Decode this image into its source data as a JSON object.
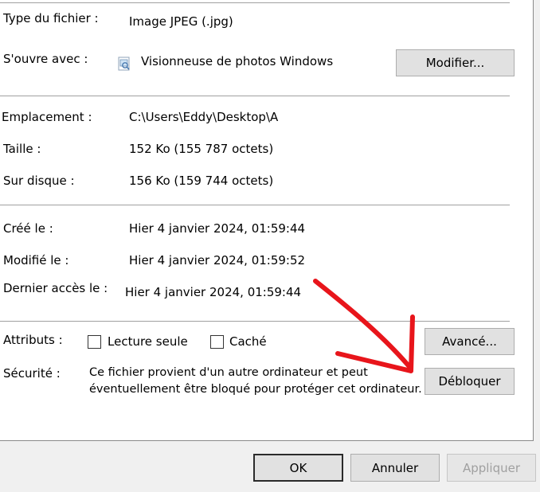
{
  "general": {
    "file_type_label": "Type du fichier :",
    "file_type_value": "Image JPEG (.jpg)",
    "opens_with_label": "S'ouvre avec :",
    "opens_with_value": "Visionneuse de photos Windows",
    "change_button": "Modifier...",
    "location_label": "Emplacement :",
    "location_value": "C:\\Users\\Eddy\\Desktop\\A",
    "size_label": "Taille :",
    "size_value": "152 Ko (155 787 octets)",
    "size_on_disk_label": "Sur disque :",
    "size_on_disk_value": "156 Ko (159 744 octets)",
    "created_label": "Créé le :",
    "created_value": "Hier 4 janvier 2024, 01:59:44",
    "modified_label": "Modifié le :",
    "modified_value": "Hier 4 janvier 2024, 01:59:52",
    "accessed_label": "Dernier accès le :",
    "accessed_value": "Hier 4 janvier 2024, 01:59:44",
    "attributes_label": "Attributs :",
    "readonly_label": "Lecture seule",
    "readonly_checked": false,
    "hidden_label": "Caché",
    "hidden_checked": false,
    "advanced_button": "Avancé...",
    "security_label": "Sécurité :",
    "security_text_line1": "Ce fichier provient d'un autre ordinateur et peut",
    "security_text_line2": "éventuellement être bloqué pour protéger cet ordinateur.",
    "unblock_button": "Débloquer"
  },
  "footer": {
    "ok_button": "OK",
    "cancel_button": "Annuler",
    "apply_button": "Appliquer",
    "apply_enabled": false
  },
  "icons": {
    "photo_viewer": "photo-viewer-icon",
    "annotation_arrow": "red-arrow"
  },
  "colors": {
    "arrow": "#e8151b",
    "button_bg": "#e1e1e1",
    "panel_bg": "#ffffff",
    "window_bg": "#f0f0f0"
  }
}
